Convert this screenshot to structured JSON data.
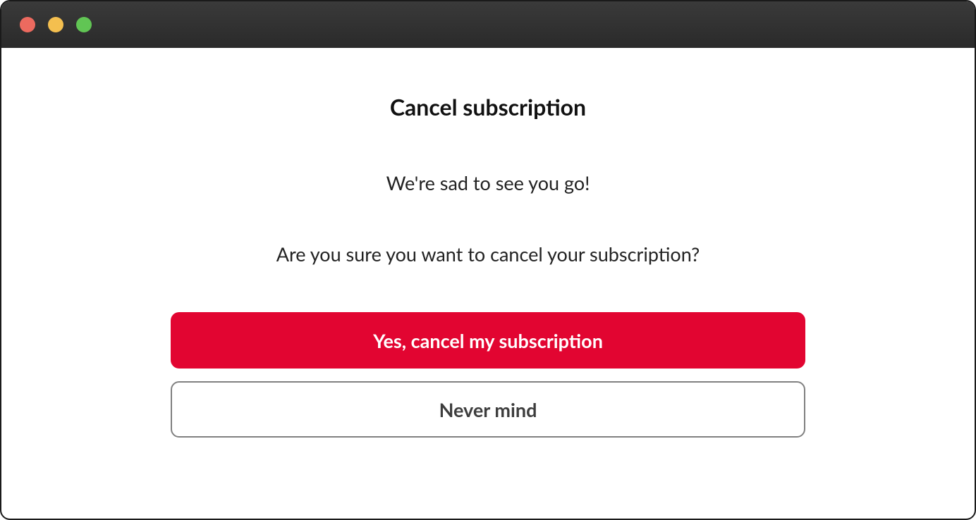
{
  "dialog": {
    "title": "Cancel subscription",
    "message_line_1": "We're sad to see you go!",
    "message_line_2": "Are you sure you want to cancel your subscription?",
    "primary_button_label": "Yes, cancel my subscription",
    "secondary_button_label": "Never mind"
  }
}
